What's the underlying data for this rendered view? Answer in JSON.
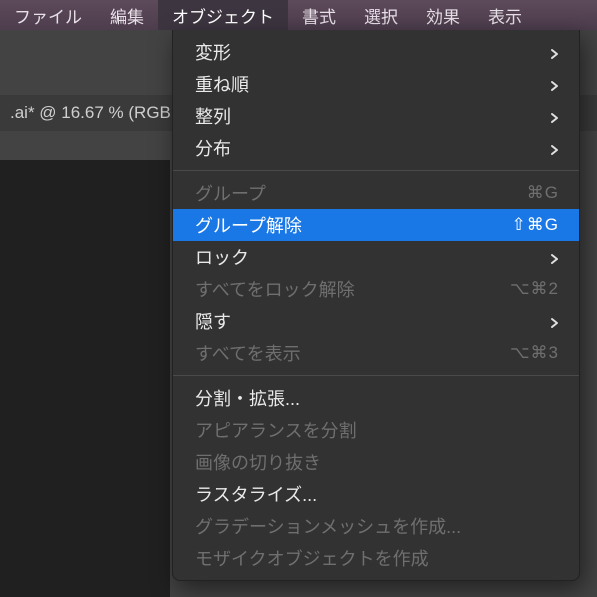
{
  "menubar": {
    "items": [
      {
        "label": "ファイル",
        "active": false
      },
      {
        "label": "編集",
        "active": false
      },
      {
        "label": "オブジェクト",
        "active": true
      },
      {
        "label": "書式",
        "active": false
      },
      {
        "label": "選択",
        "active": false
      },
      {
        "label": "効果",
        "active": false
      },
      {
        "label": "表示",
        "active": false
      }
    ]
  },
  "document": {
    "tab_label": ".ai* @ 16.67 % (RGB"
  },
  "menu": {
    "items": [
      {
        "label": "変形",
        "submenu": true,
        "enabled": true
      },
      {
        "label": "重ね順",
        "submenu": true,
        "enabled": true
      },
      {
        "label": "整列",
        "submenu": true,
        "enabled": true
      },
      {
        "label": "分布",
        "submenu": true,
        "enabled": true
      },
      {
        "sep": true
      },
      {
        "label": "グループ",
        "shortcut": "⌘G",
        "enabled": false
      },
      {
        "label": "グループ解除",
        "shortcut": "⇧⌘G",
        "enabled": true,
        "highlight": true
      },
      {
        "label": "ロック",
        "submenu": true,
        "enabled": true
      },
      {
        "label": "すべてをロック解除",
        "shortcut": "⌥⌘2",
        "enabled": false
      },
      {
        "label": "隠す",
        "submenu": true,
        "enabled": true
      },
      {
        "label": "すべてを表示",
        "shortcut": "⌥⌘3",
        "enabled": false
      },
      {
        "sep": true
      },
      {
        "label": "分割・拡張...",
        "enabled": true
      },
      {
        "label": "アピアランスを分割",
        "enabled": false
      },
      {
        "label": "画像の切り抜き",
        "enabled": false
      },
      {
        "label": "ラスタライズ...",
        "enabled": true
      },
      {
        "label": "グラデーションメッシュを作成...",
        "enabled": false
      },
      {
        "label": "モザイクオブジェクトを作成",
        "enabled": false
      }
    ]
  }
}
